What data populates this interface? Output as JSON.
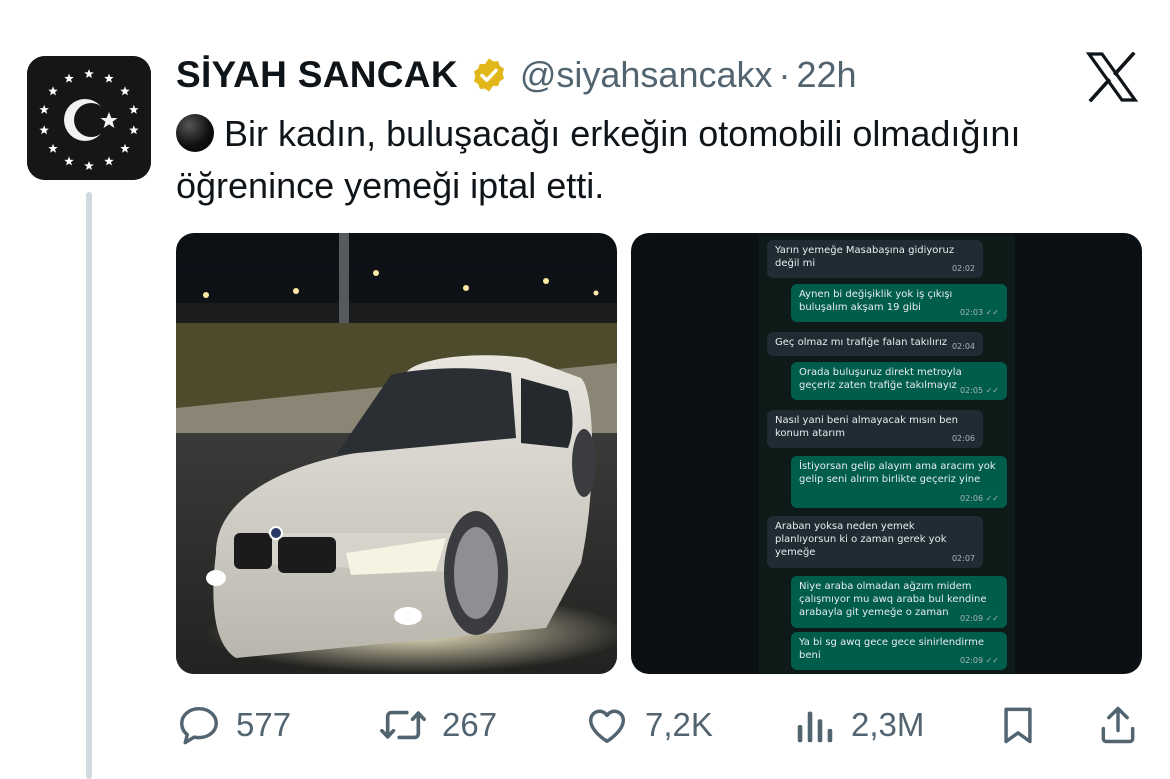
{
  "tweet": {
    "author_name": "SİYAH SANCAK",
    "handle": "@siyahsancakx",
    "separator": "·",
    "time": "22h",
    "text": "Bir kadın, buluşacağı erkeğin otomobili olmadığını öğrenince yemeği iptal etti."
  },
  "actions": {
    "replies": "577",
    "reposts": "267",
    "likes": "7,2K",
    "views": "2,3M"
  },
  "chat": {
    "messages": [
      {
        "dir": "in",
        "text": "Yarın yemeğe Masabaşına gidiyoruz\ndeğil mi",
        "time": "02:02"
      },
      {
        "dir": "out",
        "text": "Aynen bi değişiklik yok iş çıkışı\nbuluşalım akşam 19 gibi",
        "time": "02:03 ✓✓"
      },
      {
        "dir": "in",
        "text": "Geç olmaz mı trafiğe falan takılırız",
        "time": "02:04"
      },
      {
        "dir": "out",
        "text": "Orada buluşuruz direkt metroyla\ngeçeriz zaten trafiğe takılmayız",
        "time": "02:05 ✓✓"
      },
      {
        "dir": "in",
        "text": "Nasıl yani beni almayacak mısın ben\nkonum atarım",
        "time": "02:06"
      },
      {
        "dir": "out",
        "text": "İstiyorsan gelip alayım ama aracım yok\ngelip seni alırım birlikte geçeriz yine",
        "time": "02:06 ✓✓"
      },
      {
        "dir": "in",
        "text": "Araban yoksa neden yemek\nplanlıyorsun ki o zaman gerek yok\nyemeğe",
        "time": "02:07"
      },
      {
        "dir": "out",
        "text": "Niye araba olmadan ağzım midem\nçalışmıyor mu awq araba bul kendine\narabayla git yemeğe o zaman",
        "time": "02:09 ✓✓"
      },
      {
        "dir": "out",
        "text": "Ya bi sg awq gece gece sinirlendirme\nbeni",
        "time": "02:09 ✓✓"
      }
    ]
  },
  "colors": {
    "text": "#0f1419",
    "muted": "#536471",
    "verified_gold": "#e2b719",
    "chat_in": "#1f2c33",
    "chat_out": "#005c4b"
  },
  "icons": [
    "verified-badge-icon",
    "x-logo-icon",
    "reply-icon",
    "repost-icon",
    "like-icon",
    "views-icon",
    "bookmark-icon",
    "share-icon"
  ]
}
